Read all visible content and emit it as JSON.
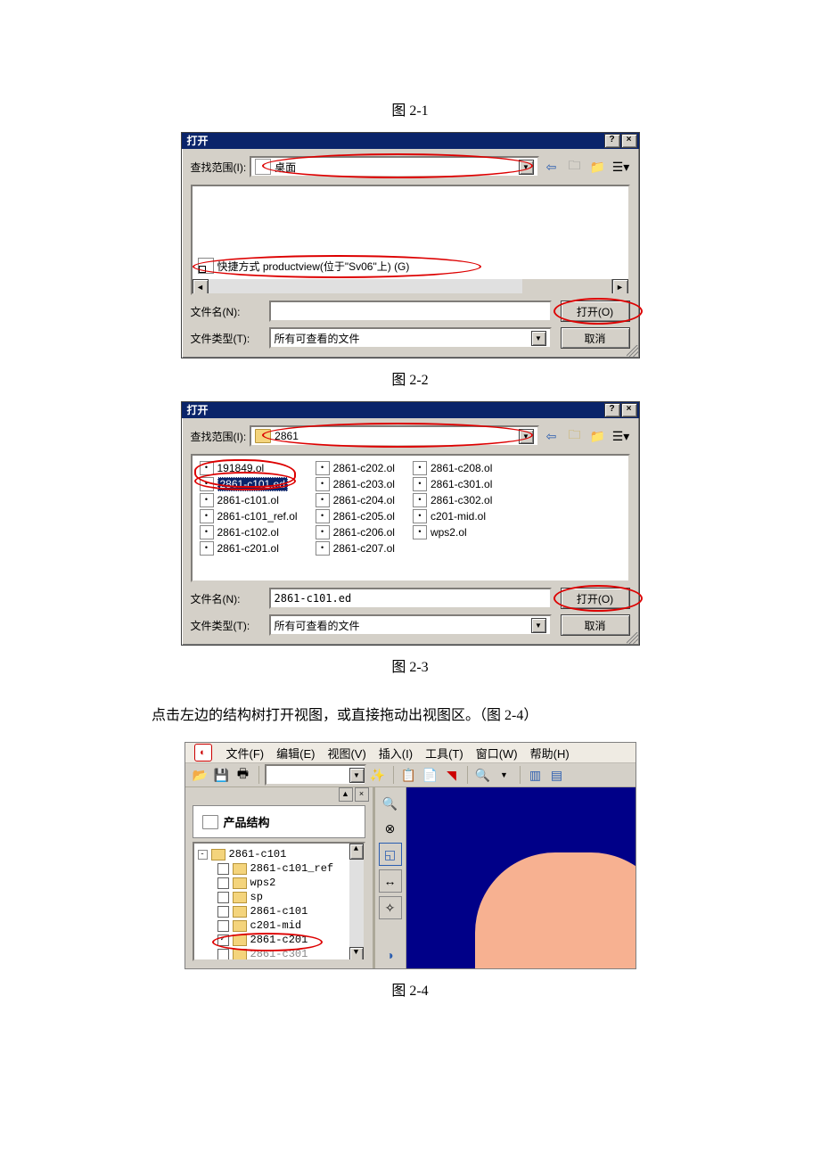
{
  "captions": {
    "fig21": "图 2-1",
    "fig22": "图 2-2",
    "fig23": "图 2-3",
    "fig24": "图 2-4"
  },
  "open_dialog1": {
    "title": "打开",
    "look_in_label": "查找范围(I):",
    "look_in_value": "桌面",
    "shortcut_label": "快捷方式 productview(位于\"Sv06\"上) (G)",
    "filename_label": "文件名(N):",
    "filename_value": "",
    "filetype_label": "文件类型(T):",
    "filetype_value": "所有可查看的文件",
    "open_btn": "打开(O)",
    "cancel_btn": "取消"
  },
  "open_dialog2": {
    "title": "打开",
    "look_in_label": "查找范围(I):",
    "look_in_value": "2861",
    "filename_label": "文件名(N):",
    "filename_value": "2861-c101.ed",
    "filetype_label": "文件类型(T):",
    "filetype_value": "所有可查看的文件",
    "open_btn": "打开(O)",
    "cancel_btn": "取消",
    "files_col1": [
      "191849.ol",
      "2861-c101.ed",
      "2861-c101.ol",
      "2861-c101_ref.ol",
      "2861-c102.ol",
      "2861-c201.ol"
    ],
    "files_col2": [
      "2861-c202.ol",
      "2861-c203.ol",
      "2861-c204.ol",
      "2861-c205.ol",
      "2861-c206.ol",
      "2861-c207.ol"
    ],
    "files_col3": [
      "2861-c208.ol",
      "2861-c301.ol",
      "2861-c302.ol",
      "c201-mid.ol",
      "wps2.ol"
    ],
    "selected": "2861-c101.ed"
  },
  "body_line": "点击左边的结构树打开视图，或直接拖动出视图区。（图 2-4）",
  "appwin": {
    "menu": {
      "file": "文件(F)",
      "edit": "编辑(E)",
      "view": "视图(V)",
      "insert": "插入(I)",
      "tools": "工具(T)",
      "window": "窗口(W)",
      "help": "帮助(H)"
    },
    "tree_title": "产品结构",
    "tree": {
      "root": "2861-c101",
      "children": [
        "2861-c101_ref",
        "wps2",
        "sp",
        "2861-c101",
        "c201-mid",
        "2861-c201",
        "2861-c301"
      ],
      "checked": "2861-c201"
    }
  }
}
